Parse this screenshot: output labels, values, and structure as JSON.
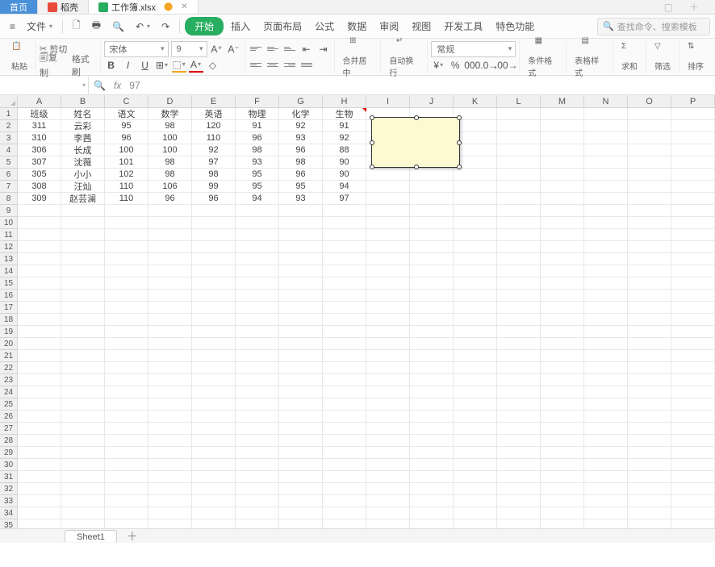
{
  "tabs": {
    "home": "首页",
    "docx": "稻壳",
    "xlsx": "工作簿.xlsx"
  },
  "menu": {
    "file": "文件",
    "items": [
      "开始",
      "插入",
      "页面布局",
      "公式",
      "数据",
      "审阅",
      "视图",
      "开发工具",
      "特色功能"
    ],
    "search_placeholder": "查找命令、搜索模板"
  },
  "ribbon": {
    "paste": "粘贴",
    "cut": "剪切",
    "copy": "复制",
    "format_painter": "格式刷",
    "font": "宋体",
    "font_size": "9",
    "merge": "合并居中",
    "wrap": "自动换行",
    "number_format": "常规",
    "cond_format": "条件格式",
    "cell_styles": "表格样式",
    "sum": "求和",
    "filter": "筛选",
    "sort": "排序"
  },
  "formula_bar": {
    "name_box": "",
    "value": "97"
  },
  "columns": [
    "A",
    "B",
    "C",
    "D",
    "E",
    "F",
    "G",
    "H",
    "I",
    "J",
    "K",
    "L",
    "M",
    "N",
    "O",
    "P"
  ],
  "headers": [
    "班级",
    "姓名",
    "语文",
    "数学",
    "英语",
    "物理",
    "化学",
    "生物"
  ],
  "rows": [
    [
      "311",
      "云彩",
      "95",
      "98",
      "120",
      "91",
      "92",
      "91"
    ],
    [
      "310",
      "李茜",
      "96",
      "100",
      "110",
      "96",
      "93",
      "92"
    ],
    [
      "306",
      "长成",
      "100",
      "100",
      "92",
      "98",
      "96",
      "88"
    ],
    [
      "307",
      "沈薇",
      "101",
      "98",
      "97",
      "93",
      "98",
      "90"
    ],
    [
      "305",
      "小小",
      "102",
      "98",
      "98",
      "95",
      "96",
      "90"
    ],
    [
      "308",
      "汪灿",
      "110",
      "106",
      "99",
      "95",
      "95",
      "94"
    ],
    [
      "309",
      "赵芸澜",
      "110",
      "96",
      "96",
      "94",
      "93",
      "97"
    ]
  ],
  "sheet_tab": "Sheet1"
}
